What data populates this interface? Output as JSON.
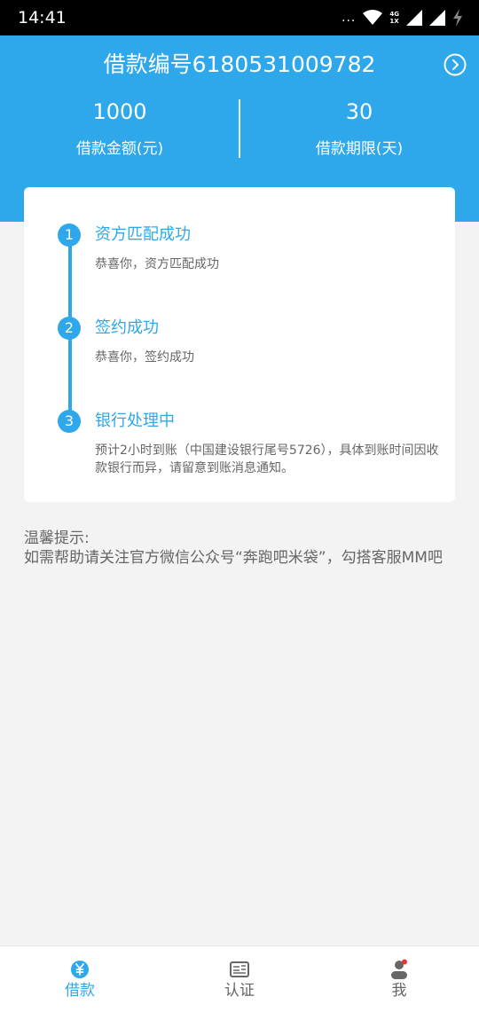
{
  "status_bar": {
    "time": "14:41",
    "dots": "...",
    "net_top": "4G",
    "net_bottom": "1X"
  },
  "header": {
    "loan_number": "借款编号6180531009782",
    "amount_value": "1000",
    "amount_label": "借款金额(元)",
    "term_value": "30",
    "term_label": "借款期限(天)",
    "next_icon": "chevron-right-circle-icon",
    "background_color": "#2ea8ea"
  },
  "progress": {
    "accent_color": "#2ea8ea",
    "steps": [
      {
        "number": "1",
        "title": "资方匹配成功",
        "desc": "恭喜你，资方匹配成功"
      },
      {
        "number": "2",
        "title": "签约成功",
        "desc": "恭喜你，签约成功"
      },
      {
        "number": "3",
        "title": "银行处理中",
        "desc": "预计2小时到账（中国建设银行尾号5726），具体到账时间因收款银行而异，请留意到账消息通知。"
      }
    ]
  },
  "tip": {
    "heading": "温馨提示:",
    "body": "如需帮助请关注官方微信公众号“奔跑吧米袋”，勾搭客服MM吧"
  },
  "bottom_nav": {
    "items": [
      {
        "label": "借款",
        "icon": "yuan-coin-icon",
        "active": true
      },
      {
        "label": "认证",
        "icon": "id-card-icon",
        "active": false
      },
      {
        "label": "我",
        "icon": "user-icon",
        "active": false,
        "badge": true
      }
    ],
    "active_color": "#2ea8ea",
    "inactive_color": "#666666"
  }
}
